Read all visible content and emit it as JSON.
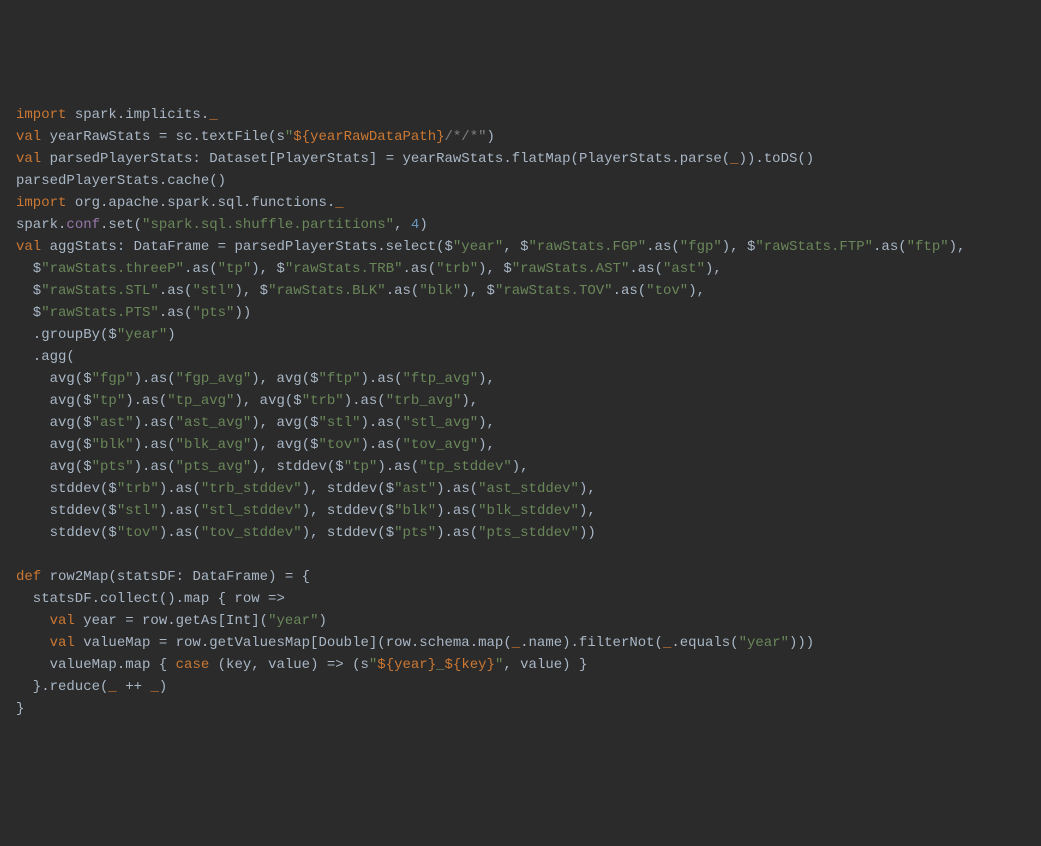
{
  "code": {
    "lines": [
      {
        "segments": [
          {
            "t": "import ",
            "c": "kw"
          },
          {
            "t": "spark.implicits.",
            "c": "id"
          },
          {
            "t": "_",
            "c": "kw"
          }
        ]
      },
      {
        "segments": [
          {
            "t": "val ",
            "c": "kw"
          },
          {
            "t": "yearRawStats ",
            "c": "id"
          },
          {
            "t": "= ",
            "c": "id"
          },
          {
            "t": "sc.textFile(s",
            "c": "id"
          },
          {
            "t": "\"",
            "c": "str"
          },
          {
            "t": "${yearRawDataPath}",
            "c": "interp"
          },
          {
            "t": "/*/*\"",
            "c": "cmt"
          },
          {
            "t": ")",
            "c": "id"
          }
        ]
      },
      {
        "segments": [
          {
            "t": "val ",
            "c": "kw"
          },
          {
            "t": "parsedPlayerStats: ",
            "c": "id"
          },
          {
            "t": "Dataset",
            "c": "type"
          },
          {
            "t": "[",
            "c": "id"
          },
          {
            "t": "PlayerStats",
            "c": "type"
          },
          {
            "t": "] = yearRawStats.flatMap(",
            "c": "id"
          },
          {
            "t": "PlayerStats",
            "c": "type"
          },
          {
            "t": ".parse(",
            "c": "id"
          },
          {
            "t": "_",
            "c": "kw"
          },
          {
            "t": ")).toDS()",
            "c": "id"
          }
        ]
      },
      {
        "segments": [
          {
            "t": "parsedPlayerStats.cache()",
            "c": "id"
          }
        ]
      },
      {
        "segments": [
          {
            "t": "import ",
            "c": "kw"
          },
          {
            "t": "org.apache.spark.sql.functions.",
            "c": "id"
          },
          {
            "t": "_",
            "c": "kw"
          }
        ]
      },
      {
        "segments": [
          {
            "t": "spark.",
            "c": "id"
          },
          {
            "t": "conf",
            "c": "mem"
          },
          {
            "t": ".set(",
            "c": "id"
          },
          {
            "t": "\"spark.sql.shuffle.partitions\"",
            "c": "str"
          },
          {
            "t": ", ",
            "c": "id"
          },
          {
            "t": "4",
            "c": "num"
          },
          {
            "t": ")",
            "c": "id"
          }
        ]
      },
      {
        "segments": [
          {
            "t": "val ",
            "c": "kw"
          },
          {
            "t": "aggStats: ",
            "c": "id"
          },
          {
            "t": "DataFrame",
            "c": "type"
          },
          {
            "t": " = parsedPlayerStats.select($",
            "c": "id"
          },
          {
            "t": "\"year\"",
            "c": "str"
          },
          {
            "t": ", $",
            "c": "id"
          },
          {
            "t": "\"rawStats.FGP\"",
            "c": "str"
          },
          {
            "t": ".as(",
            "c": "id"
          },
          {
            "t": "\"fgp\"",
            "c": "str"
          },
          {
            "t": "), $",
            "c": "id"
          },
          {
            "t": "\"rawStats.FTP\"",
            "c": "str"
          },
          {
            "t": ".as(",
            "c": "id"
          },
          {
            "t": "\"ftp\"",
            "c": "str"
          },
          {
            "t": "),",
            "c": "id"
          }
        ]
      },
      {
        "segments": [
          {
            "t": "  $",
            "c": "id"
          },
          {
            "t": "\"rawStats.threeP\"",
            "c": "str"
          },
          {
            "t": ".as(",
            "c": "id"
          },
          {
            "t": "\"tp\"",
            "c": "str"
          },
          {
            "t": "), $",
            "c": "id"
          },
          {
            "t": "\"rawStats.TRB\"",
            "c": "str"
          },
          {
            "t": ".as(",
            "c": "id"
          },
          {
            "t": "\"trb\"",
            "c": "str"
          },
          {
            "t": "), $",
            "c": "id"
          },
          {
            "t": "\"rawStats.AST\"",
            "c": "str"
          },
          {
            "t": ".as(",
            "c": "id"
          },
          {
            "t": "\"ast\"",
            "c": "str"
          },
          {
            "t": "),",
            "c": "id"
          }
        ]
      },
      {
        "segments": [
          {
            "t": "  $",
            "c": "id"
          },
          {
            "t": "\"rawStats.STL\"",
            "c": "str"
          },
          {
            "t": ".as(",
            "c": "id"
          },
          {
            "t": "\"stl\"",
            "c": "str"
          },
          {
            "t": "), $",
            "c": "id"
          },
          {
            "t": "\"rawStats.BLK\"",
            "c": "str"
          },
          {
            "t": ".as(",
            "c": "id"
          },
          {
            "t": "\"blk\"",
            "c": "str"
          },
          {
            "t": "), $",
            "c": "id"
          },
          {
            "t": "\"rawStats.TOV\"",
            "c": "str"
          },
          {
            "t": ".as(",
            "c": "id"
          },
          {
            "t": "\"tov\"",
            "c": "str"
          },
          {
            "t": "),",
            "c": "id"
          }
        ]
      },
      {
        "segments": [
          {
            "t": "  $",
            "c": "id"
          },
          {
            "t": "\"rawStats.PTS\"",
            "c": "str"
          },
          {
            "t": ".as(",
            "c": "id"
          },
          {
            "t": "\"pts\"",
            "c": "str"
          },
          {
            "t": "))",
            "c": "id"
          }
        ]
      },
      {
        "segments": [
          {
            "t": "  .groupBy($",
            "c": "id"
          },
          {
            "t": "\"year\"",
            "c": "str"
          },
          {
            "t": ")",
            "c": "id"
          }
        ]
      },
      {
        "segments": [
          {
            "t": "  .agg(",
            "c": "id"
          }
        ]
      },
      {
        "segments": [
          {
            "t": "    avg($",
            "c": "id"
          },
          {
            "t": "\"fgp\"",
            "c": "str"
          },
          {
            "t": ").as(",
            "c": "id"
          },
          {
            "t": "\"fgp_avg\"",
            "c": "str"
          },
          {
            "t": "), avg($",
            "c": "id"
          },
          {
            "t": "\"ftp\"",
            "c": "str"
          },
          {
            "t": ").as(",
            "c": "id"
          },
          {
            "t": "\"ftp_avg\"",
            "c": "str"
          },
          {
            "t": "),",
            "c": "id"
          }
        ]
      },
      {
        "segments": [
          {
            "t": "    avg($",
            "c": "id"
          },
          {
            "t": "\"tp\"",
            "c": "str"
          },
          {
            "t": ").as(",
            "c": "id"
          },
          {
            "t": "\"tp_avg\"",
            "c": "str"
          },
          {
            "t": "), avg($",
            "c": "id"
          },
          {
            "t": "\"trb\"",
            "c": "str"
          },
          {
            "t": ").as(",
            "c": "id"
          },
          {
            "t": "\"trb_avg\"",
            "c": "str"
          },
          {
            "t": "),",
            "c": "id"
          }
        ]
      },
      {
        "segments": [
          {
            "t": "    avg($",
            "c": "id"
          },
          {
            "t": "\"ast\"",
            "c": "str"
          },
          {
            "t": ").as(",
            "c": "id"
          },
          {
            "t": "\"ast_avg\"",
            "c": "str"
          },
          {
            "t": "), avg($",
            "c": "id"
          },
          {
            "t": "\"stl\"",
            "c": "str"
          },
          {
            "t": ").as(",
            "c": "id"
          },
          {
            "t": "\"stl_avg\"",
            "c": "str"
          },
          {
            "t": "),",
            "c": "id"
          }
        ]
      },
      {
        "segments": [
          {
            "t": "    avg($",
            "c": "id"
          },
          {
            "t": "\"blk\"",
            "c": "str"
          },
          {
            "t": ").as(",
            "c": "id"
          },
          {
            "t": "\"blk_avg\"",
            "c": "str"
          },
          {
            "t": "), avg($",
            "c": "id"
          },
          {
            "t": "\"tov\"",
            "c": "str"
          },
          {
            "t": ").as(",
            "c": "id"
          },
          {
            "t": "\"tov_avg\"",
            "c": "str"
          },
          {
            "t": "),",
            "c": "id"
          }
        ]
      },
      {
        "segments": [
          {
            "t": "    avg($",
            "c": "id"
          },
          {
            "t": "\"pts\"",
            "c": "str"
          },
          {
            "t": ").as(",
            "c": "id"
          },
          {
            "t": "\"pts_avg\"",
            "c": "str"
          },
          {
            "t": "), stddev($",
            "c": "id"
          },
          {
            "t": "\"tp\"",
            "c": "str"
          },
          {
            "t": ").as(",
            "c": "id"
          },
          {
            "t": "\"tp_stddev\"",
            "c": "str"
          },
          {
            "t": "),",
            "c": "id"
          }
        ]
      },
      {
        "segments": [
          {
            "t": "    stddev($",
            "c": "id"
          },
          {
            "t": "\"trb\"",
            "c": "str"
          },
          {
            "t": ").as(",
            "c": "id"
          },
          {
            "t": "\"trb_stddev\"",
            "c": "str"
          },
          {
            "t": "), stddev($",
            "c": "id"
          },
          {
            "t": "\"ast\"",
            "c": "str"
          },
          {
            "t": ").as(",
            "c": "id"
          },
          {
            "t": "\"ast_stddev\"",
            "c": "str"
          },
          {
            "t": "),",
            "c": "id"
          }
        ]
      },
      {
        "segments": [
          {
            "t": "    stddev($",
            "c": "id"
          },
          {
            "t": "\"stl\"",
            "c": "str"
          },
          {
            "t": ").as(",
            "c": "id"
          },
          {
            "t": "\"stl_stddev\"",
            "c": "str"
          },
          {
            "t": "), stddev($",
            "c": "id"
          },
          {
            "t": "\"blk\"",
            "c": "str"
          },
          {
            "t": ").as(",
            "c": "id"
          },
          {
            "t": "\"blk_stddev\"",
            "c": "str"
          },
          {
            "t": "),",
            "c": "id"
          }
        ]
      },
      {
        "segments": [
          {
            "t": "    stddev($",
            "c": "id"
          },
          {
            "t": "\"tov\"",
            "c": "str"
          },
          {
            "t": ").as(",
            "c": "id"
          },
          {
            "t": "\"tov_stddev\"",
            "c": "str"
          },
          {
            "t": "), stddev($",
            "c": "id"
          },
          {
            "t": "\"pts\"",
            "c": "str"
          },
          {
            "t": ").as(",
            "c": "id"
          },
          {
            "t": "\"pts_stddev\"",
            "c": "str"
          },
          {
            "t": "))",
            "c": "id"
          }
        ]
      },
      {
        "segments": [
          {
            "t": "",
            "c": "id"
          }
        ]
      },
      {
        "segments": [
          {
            "t": "def ",
            "c": "kw"
          },
          {
            "t": "row2Map(statsDF: ",
            "c": "id"
          },
          {
            "t": "DataFrame",
            "c": "type"
          },
          {
            "t": ") = {",
            "c": "id"
          }
        ]
      },
      {
        "segments": [
          {
            "t": "  statsDF.collect().map { row =>",
            "c": "id"
          }
        ]
      },
      {
        "segments": [
          {
            "t": "    ",
            "c": "id"
          },
          {
            "t": "val ",
            "c": "kw"
          },
          {
            "t": "year = row.getAs[",
            "c": "id"
          },
          {
            "t": "Int",
            "c": "type"
          },
          {
            "t": "](",
            "c": "id"
          },
          {
            "t": "\"year\"",
            "c": "str"
          },
          {
            "t": ")",
            "c": "id"
          }
        ]
      },
      {
        "segments": [
          {
            "t": "    ",
            "c": "id"
          },
          {
            "t": "val ",
            "c": "kw"
          },
          {
            "t": "valueMap = row.getValuesMap[",
            "c": "id"
          },
          {
            "t": "Double",
            "c": "type"
          },
          {
            "t": "](row.schema.map(",
            "c": "id"
          },
          {
            "t": "_",
            "c": "kw"
          },
          {
            "t": ".name).filterNot(",
            "c": "id"
          },
          {
            "t": "_",
            "c": "kw"
          },
          {
            "t": ".equals(",
            "c": "id"
          },
          {
            "t": "\"year\"",
            "c": "str"
          },
          {
            "t": ")))",
            "c": "id"
          }
        ]
      },
      {
        "segments": [
          {
            "t": "    valueMap.map { ",
            "c": "id"
          },
          {
            "t": "case ",
            "c": "kw"
          },
          {
            "t": "(key, value) => (s",
            "c": "id"
          },
          {
            "t": "\"",
            "c": "str"
          },
          {
            "t": "${year}",
            "c": "interp"
          },
          {
            "t": "_",
            "c": "str"
          },
          {
            "t": "${key}",
            "c": "interp"
          },
          {
            "t": "\"",
            "c": "str"
          },
          {
            "t": ", value) }",
            "c": "id"
          }
        ]
      },
      {
        "segments": [
          {
            "t": "  }.reduce(",
            "c": "id"
          },
          {
            "t": "_ ",
            "c": "kw"
          },
          {
            "t": "++ ",
            "c": "id"
          },
          {
            "t": "_",
            "c": "kw"
          },
          {
            "t": ")",
            "c": "id"
          }
        ]
      },
      {
        "segments": [
          {
            "t": "}",
            "c": "id"
          }
        ]
      }
    ]
  }
}
